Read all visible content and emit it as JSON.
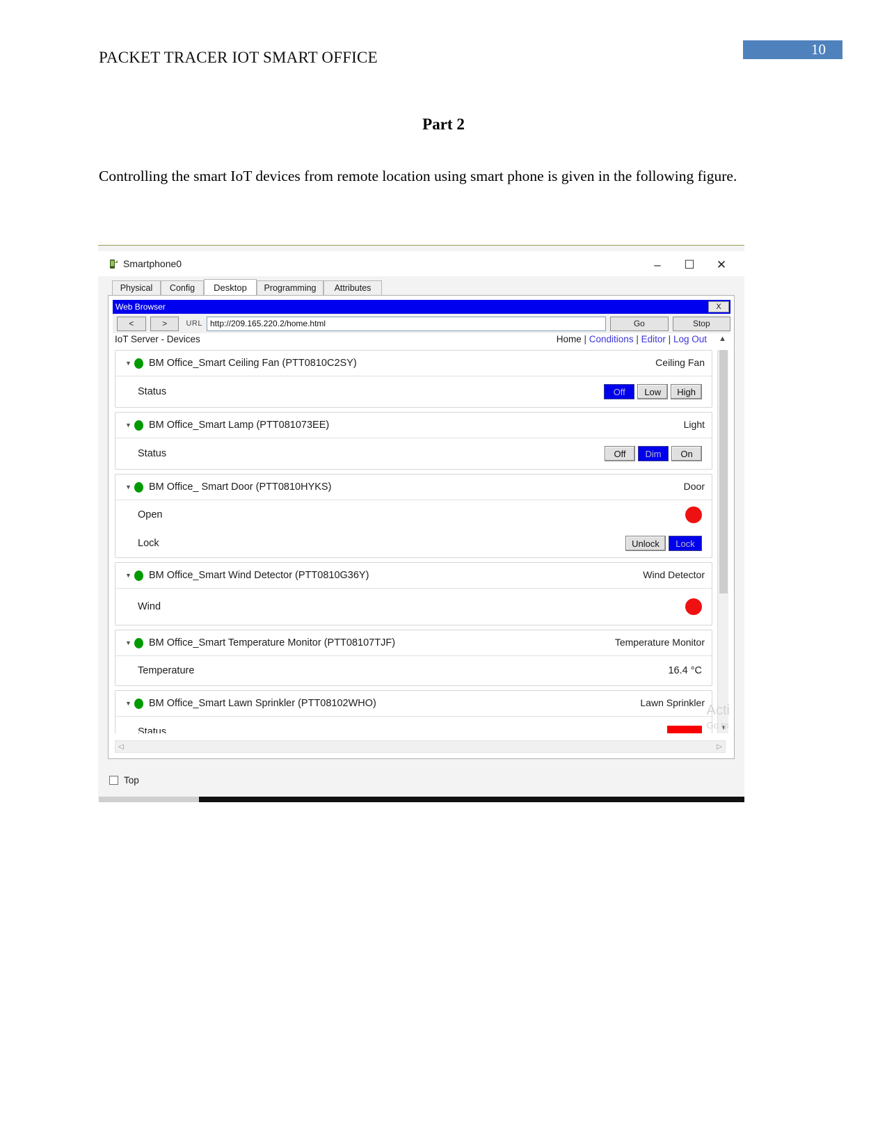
{
  "document": {
    "header_title": "PACKET TRACER IOT SMART OFFICE",
    "page_number": "10",
    "page_badge_color": "#4f81bd",
    "part_title": "Part 2",
    "paragraph": "Controlling the smart IoT devices from remote location using smart phone is given in the following figure."
  },
  "window": {
    "title": "Smartphone0",
    "icon": "device-icon",
    "minimize": "–",
    "maximize": "☐",
    "close": "✕",
    "tabs": [
      {
        "label": "Physical",
        "active": false
      },
      {
        "label": "Config",
        "active": false
      },
      {
        "label": "Desktop",
        "active": true
      },
      {
        "label": "Programming",
        "active": false
      },
      {
        "label": "Attributes",
        "active": false
      }
    ],
    "top_checkbox_label": "Top",
    "watermark_line1": "Acti",
    "watermark_line2": "Go to"
  },
  "browser": {
    "title": "Web Browser",
    "close_label": "X",
    "back_label": "<",
    "forward_label": ">",
    "url_label": "URL",
    "url_value": "http://209.165.220.2/home.html",
    "go_label": "Go",
    "stop_label": "Stop"
  },
  "iot_page": {
    "heading": "IoT Server - Devices",
    "nav": [
      {
        "label": "Home",
        "link": false
      },
      {
        "label": "Conditions",
        "link": true
      },
      {
        "label": "Editor",
        "link": true
      },
      {
        "label": "Log Out",
        "link": true
      }
    ],
    "nav_separator": "|",
    "status_dot_color": "#009a00",
    "selected_color": "#0000ee",
    "led_on_color": "#ef1111",
    "devices": [
      {
        "name": "BM Office_Smart Ceiling Fan (PTT0810C2SY)",
        "type": "Ceiling Fan",
        "rows": [
          {
            "label": "Status",
            "control": "segmented",
            "options": [
              "Off",
              "Low",
              "High"
            ],
            "selected": "Off"
          }
        ]
      },
      {
        "name": "BM Office_Smart Lamp (PTT081073EE)",
        "type": "Light",
        "rows": [
          {
            "label": "Status",
            "control": "segmented",
            "options": [
              "Off",
              "Dim",
              "On"
            ],
            "selected": "Dim"
          }
        ]
      },
      {
        "name": "BM Office_ Smart Door (PTT0810HYKS)",
        "type": "Door",
        "rows": [
          {
            "label": "Open",
            "control": "led",
            "value": "on"
          },
          {
            "label": "Lock",
            "control": "segmented",
            "options": [
              "Unlock",
              "Lock"
            ],
            "selected": "Lock"
          }
        ]
      },
      {
        "name": "BM Office_Smart Wind Detector (PTT0810G36Y)",
        "type": "Wind Detector",
        "rows": [
          {
            "label": "Wind",
            "control": "led",
            "value": "on"
          }
        ]
      },
      {
        "name": "BM Office_Smart Temperature Monitor (PTT08107TJF)",
        "type": "Temperature Monitor",
        "rows": [
          {
            "label": "Temperature",
            "control": "value",
            "value": "16.4 °C"
          }
        ]
      },
      {
        "name": "BM Office_Smart Lawn Sprinkler (PTT08102WHO)",
        "type": "Lawn Sprinkler",
        "rows": [
          {
            "label": "Status",
            "control": "led-rect",
            "value": "on"
          }
        ]
      }
    ]
  }
}
